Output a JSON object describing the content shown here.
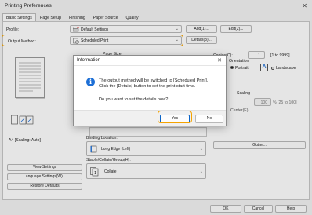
{
  "window": {
    "title": "Printing Preferences",
    "close_glyph": "✕"
  },
  "tabs": [
    "Basic Settings",
    "Page Setup",
    "Finishing",
    "Paper Source",
    "Quality"
  ],
  "profile": {
    "label": "Profile:",
    "value": "Default Settings",
    "add_label": "Add(1)...",
    "edit_label": "Edit(2)..."
  },
  "output_method": {
    "label": "Output Method:",
    "value": "Scheduled Print",
    "details_label": "Details(3)..."
  },
  "behind": {
    "page_size_label": "Page Size:",
    "copies_label": "Copies(C):",
    "copies_value": "1",
    "copies_range": "[1 to 9999]",
    "orientation_label": "Orientation",
    "portrait_label": "Portrait",
    "landscape_label": "Landscape",
    "scaling_label": "Scaling",
    "scaling_value": "100",
    "scaling_range": "% [25 to 100]",
    "center_label": "Center(E)",
    "preview_caption": "A4 [Scaling: Auto]",
    "binding_location_label": "Binding Location:",
    "binding_location_value": "Long Edge (Left)",
    "gutter_label": "Gutter...",
    "staple_label": "Staple/Collate/Group(H):",
    "staple_value": "Collate",
    "view_settings_label": "View Settings",
    "language_settings_label": "Language Settings(W)...",
    "restore_defaults_label": "Restore Defaults"
  },
  "footer": {
    "ok": "OK",
    "cancel": "Cancel",
    "apply": "Apply",
    "help": "Help"
  },
  "dialog": {
    "title": "Information",
    "line1": "The output method will be switched to [Scheduled Print].",
    "line2": "Click the [Details] button to set the print start time.",
    "question": "Do you want to set the details now?",
    "yes": "Yes",
    "no": "No"
  },
  "colors": {
    "highlight": "#f4a300",
    "info_icon": "#1d6fd6",
    "primary_button_border": "#0a64c8"
  }
}
